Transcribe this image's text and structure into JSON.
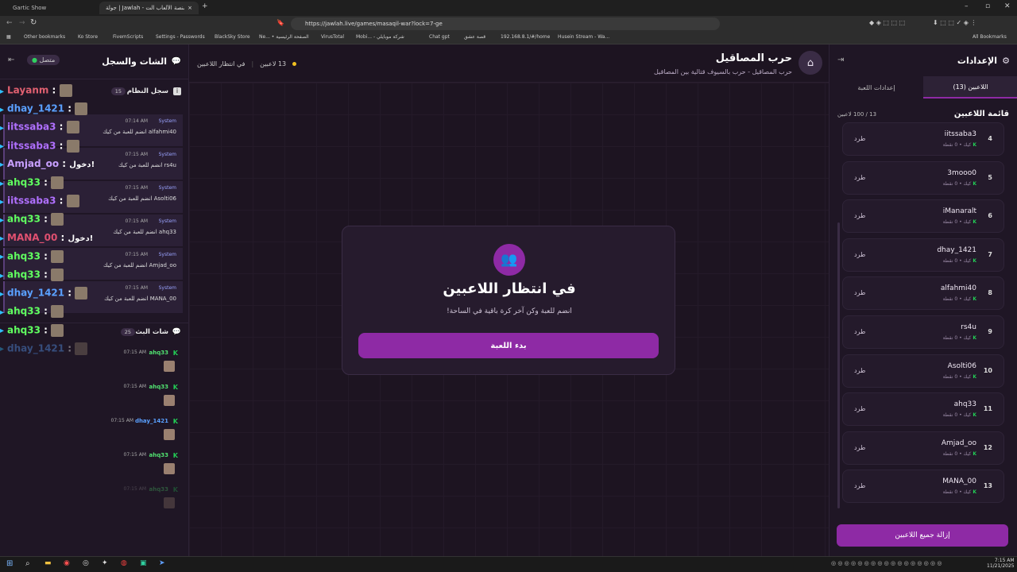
{
  "browser": {
    "tabs": [
      {
        "title": "Gartic Show"
      },
      {
        "title": "جولة | Jawlah - منصة الألعاب الت..."
      }
    ],
    "url": "https://jawlah.live/games/masaqil-war?lock=7-ge",
    "bookmarks": [
      "Other bookmarks",
      "Ko Store",
      "FivemScripts",
      "Settings - Passwords",
      "BlackSky Store",
      "Ne... • الصفحة الرئيسية",
      "VirusTotal",
      "Mobi... - شركة موبايلي",
      "Chat gpt",
      "قصة عشق",
      "192.168.8.1/#/home",
      "Husein Stream - Wa...",
      "All Bookmarks"
    ]
  },
  "left_panel": {
    "title": "الشات والسجل",
    "status": "متصل",
    "system_log": {
      "title": "سجل النظام",
      "count": "15"
    },
    "broadcast": {
      "title": "شات البث",
      "count": "25"
    },
    "overlay_chat": [
      {
        "user": "Layanm",
        "color": "#e06070",
        "text": ""
      },
      {
        "user": "dhay_1421",
        "color": "#5aa0ff",
        "text": ""
      },
      {
        "user": "iitssaba3",
        "color": "#b070ff",
        "text": ""
      },
      {
        "user": "iitssaba3",
        "color": "#b070ff",
        "text": ""
      },
      {
        "user": "Amjad_oo",
        "color": "#c8a0ff",
        "text": "دخول!"
      },
      {
        "user": "ahq33",
        "color": "#60ff60",
        "text": ""
      },
      {
        "user": "iitssaba3",
        "color": "#b070ff",
        "text": ""
      },
      {
        "user": "ahq33",
        "color": "#60ff60",
        "text": ""
      },
      {
        "user": "MANA_00",
        "color": "#e05070",
        "text": "دخول!"
      },
      {
        "user": "ahq33",
        "color": "#60ff60",
        "text": ""
      },
      {
        "user": "ahq33",
        "color": "#60ff60",
        "text": ""
      },
      {
        "user": "dhay_1421",
        "color": "#5aa0ff",
        "text": ""
      },
      {
        "user": "ahq33",
        "color": "#60ff60",
        "text": ""
      },
      {
        "user": "ahq33",
        "color": "#60ff60",
        "text": ""
      },
      {
        "user": "dhay_1421",
        "color": "#5aa0ff",
        "text": ""
      }
    ],
    "system_entries": [
      {
        "sender": "System",
        "time": "07:14 AM",
        "text": "alfahmi40 انضم للعبة من كيك"
      },
      {
        "sender": "System",
        "time": "07:15 AM",
        "text": "rs4u انضم للعبة من كيك"
      },
      {
        "sender": "System",
        "time": "07:15 AM",
        "text": "Asolti06 انضم للعبة من كيك"
      },
      {
        "sender": "System",
        "time": "07:15 AM",
        "text": "ahq33 انضم للعبة من كيك"
      },
      {
        "sender": "System",
        "time": "07:15 AM",
        "text": "Amjad_oo انضم للعبة من كيك"
      },
      {
        "sender": "System",
        "time": "07:15 AM",
        "text": "MANA_00 انضم للعبة من كيك"
      }
    ],
    "broadcast_entries": [
      {
        "name": "ahq33",
        "time": "07:15 AM",
        "color": "#50e070"
      },
      {
        "name": "ahq33",
        "time": "07:15 AM",
        "color": "#50e070"
      },
      {
        "name": "dhay_1421",
        "time": "07:15 AM",
        "color": "#5aa0ff"
      },
      {
        "name": "ahq33",
        "time": "07:15 AM",
        "color": "#50e070"
      },
      {
        "name": "ahq33",
        "time": "07:15 AM",
        "color": "#50e070"
      }
    ]
  },
  "header": {
    "game_title": "حرب المصاقيل",
    "game_subtitle": "حرب المصاقيل - حرب بالسيوف قتالية بين المصاقيل",
    "players_count": "13 لاعبين",
    "status": "في انتظار اللاعبين"
  },
  "waiting_card": {
    "title": "في انتظار اللاعبين",
    "subtitle": "انضم للعبة وكن آخر كرة باقية في الساحة!",
    "start_button": "بدء اللعبة"
  },
  "settings_panel": {
    "title": "الإعدادات",
    "tab_players": "اللاعبين (13)",
    "tab_game_settings": "إعدادات اللعبة",
    "list_title": "قائمة اللاعبين",
    "list_count": "13 / 100 لاعبين",
    "kick_label": "طرد",
    "meta_label": "كيك • 0 نقطة",
    "remove_all": "إزالة جميع اللاعبين",
    "players": [
      {
        "num": "4",
        "name": "iitssaba3"
      },
      {
        "num": "5",
        "name": "3mooo0"
      },
      {
        "num": "6",
        "name": "iManaralt"
      },
      {
        "num": "7",
        "name": "dhay_1421"
      },
      {
        "num": "8",
        "name": "alfahmi40"
      },
      {
        "num": "9",
        "name": "rs4u"
      },
      {
        "num": "10",
        "name": "Asolti06"
      },
      {
        "num": "11",
        "name": "ahq33"
      },
      {
        "num": "12",
        "name": "Amjad_oo"
      },
      {
        "num": "13",
        "name": "MANA_00"
      }
    ]
  },
  "taskbar": {
    "time": "7:15 AM",
    "date": "11/21/2025"
  }
}
